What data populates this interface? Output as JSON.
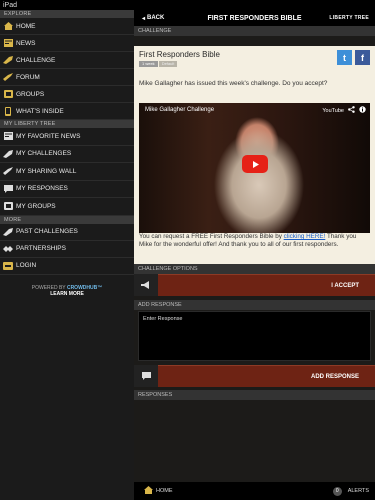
{
  "status": {
    "carrier": "iPad",
    "time": "",
    "battery": ""
  },
  "sidebar": {
    "explore_head": "EXPLORE",
    "explore": [
      {
        "label": "HOME",
        "icon": "home-icon"
      },
      {
        "label": "NEWS",
        "icon": "news-icon"
      },
      {
        "label": "CHALLENGE",
        "icon": "challenge-icon"
      },
      {
        "label": "FORUM",
        "icon": "forum-icon"
      },
      {
        "label": "GROUPS",
        "icon": "groups-icon"
      },
      {
        "label": "WHAT'S INSIDE",
        "icon": "phone-icon"
      }
    ],
    "my_head": "MY LIBERTY TREE",
    "my": [
      {
        "label": "MY FAVORITE NEWS",
        "icon": "news-icon"
      },
      {
        "label": "MY CHALLENGES",
        "icon": "challenge-icon"
      },
      {
        "label": "MY SHARING WALL",
        "icon": "wall-icon"
      },
      {
        "label": "MY RESPONSES",
        "icon": "responses-icon"
      },
      {
        "label": "MY GROUPS",
        "icon": "groups-icon"
      }
    ],
    "more_head": "MORE",
    "more": [
      {
        "label": "PAST CHALLENGES",
        "icon": "challenge-icon"
      },
      {
        "label": "PARTNERSHIPS",
        "icon": "partnership-icon"
      },
      {
        "label": "LOGIN",
        "icon": "login-icon"
      }
    ],
    "powered_by": "POWERED BY",
    "powered_brand": "CROWDHUB™",
    "learn_more": "LEARN MORE"
  },
  "header": {
    "back": "BACK",
    "title": "FIRST RESPONDERS BIBLE",
    "logo": "LIBERTY TREE"
  },
  "challenge": {
    "section_label": "CHALLENGE",
    "title": "First Responders Bible",
    "tags": [
      "1 week",
      "Default"
    ],
    "description": "Mike Gallagher has issued this week's challenge. Do you accept?",
    "video_title": "Mike Gallagher Challenge",
    "video_brand": "YouTube",
    "footer_pre": "You can request a FREE First Responders Bible by ",
    "footer_link": "clicking HERE!",
    "footer_post": " Thank you Mike for the wonderful offer! And thank you to all of our first responders."
  },
  "options": {
    "label": "CHALLENGE OPTIONS",
    "accept": "I ACCEPT"
  },
  "add_response": {
    "label": "ADD RESPONSE",
    "placeholder": "Enter Response",
    "button": "ADD RESPONSE"
  },
  "responses": {
    "label": "RESPONSES"
  },
  "bottom": {
    "home": "HOME",
    "alerts_count": "0",
    "alerts": "ALERTS"
  },
  "colors": {
    "accent_gold": "#d9b64a",
    "button_red": "#6e2314",
    "card_bg": "#f4efe1"
  }
}
